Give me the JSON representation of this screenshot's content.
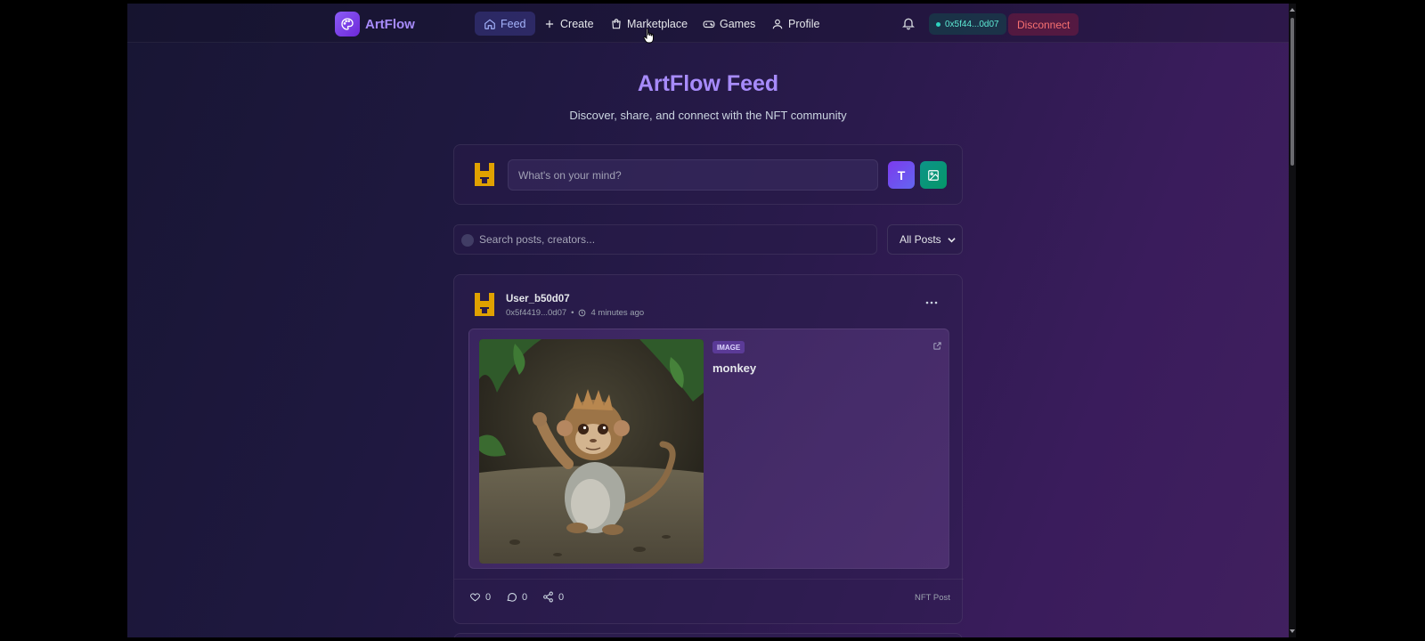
{
  "brand": {
    "name": "ArtFlow",
    "logo_icon": "palette-icon",
    "accent": "#a78bfa"
  },
  "nav": {
    "items": [
      {
        "label": "Feed",
        "icon": "home-icon",
        "active": true
      },
      {
        "label": "Create",
        "icon": "plus-icon",
        "active": false
      },
      {
        "label": "Marketplace",
        "icon": "shopping-bag-icon",
        "active": false
      },
      {
        "label": "Games",
        "icon": "gamepad-icon",
        "active": false
      },
      {
        "label": "Profile",
        "icon": "user-icon",
        "active": false
      }
    ]
  },
  "header": {
    "wallet_address": "0x5f44...0d07",
    "disconnect_label": "Disconnect"
  },
  "page": {
    "title": "ArtFlow Feed",
    "subtitle": "Discover, share, and connect with the NFT community"
  },
  "composer": {
    "placeholder": "What's on your mind?",
    "text_button": "T"
  },
  "search": {
    "placeholder": "Search posts, creators...",
    "filter_value": "All Posts"
  },
  "post": {
    "username": "User_b50d07",
    "address": "0x5f4419...0d07",
    "separator": "•",
    "time": "4 minutes ago",
    "badge": "IMAGE",
    "title": "monkey",
    "likes": "0",
    "comments": "0",
    "shares": "0",
    "tag": "NFT Post"
  }
}
